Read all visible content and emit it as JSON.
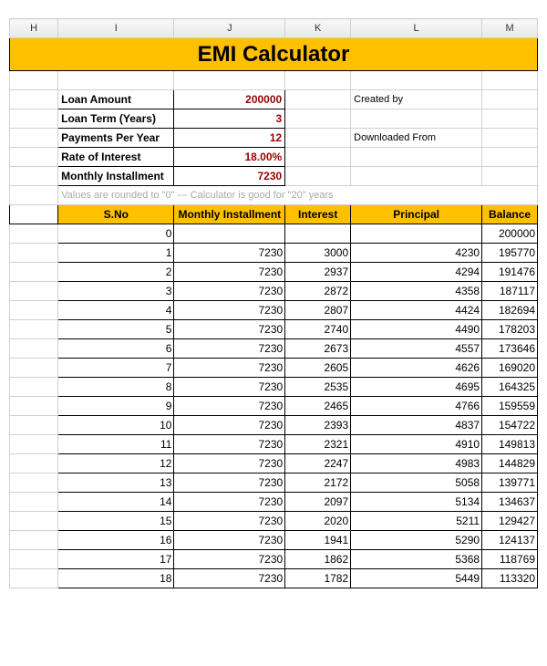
{
  "cols": [
    "H",
    "I",
    "J",
    "K",
    "L",
    "M"
  ],
  "title": "EMI Calculator",
  "inputs": {
    "loan_amount_label": "Loan Amount",
    "loan_amount_value": "200000",
    "loan_term_label": "Loan Term (Years)",
    "loan_term_value": "3",
    "payments_per_year_label": "Payments Per Year",
    "payments_per_year_value": "12",
    "rate_label": "Rate of Interest",
    "rate_value": "18.00%",
    "monthly_installment_label": "Monthly Installment",
    "monthly_installment_value": "7230"
  },
  "side": {
    "created_by": "Created by",
    "downloaded_from": "Downloaded From"
  },
  "note": "Values are rounded to \"0\"  ---  Calculator is good for \"20\" years",
  "table_headers": {
    "sno": "S.No",
    "monthly": "Monthly Installment",
    "interest": "Interest",
    "principal": "Principal",
    "balance": "Balance"
  },
  "rows": [
    {
      "sno": "0",
      "monthly": "",
      "interest": "",
      "principal": "",
      "balance": "200000"
    },
    {
      "sno": "1",
      "monthly": "7230",
      "interest": "3000",
      "principal": "4230",
      "balance": "195770"
    },
    {
      "sno": "2",
      "monthly": "7230",
      "interest": "2937",
      "principal": "4294",
      "balance": "191476"
    },
    {
      "sno": "3",
      "monthly": "7230",
      "interest": "2872",
      "principal": "4358",
      "balance": "187117"
    },
    {
      "sno": "4",
      "monthly": "7230",
      "interest": "2807",
      "principal": "4424",
      "balance": "182694"
    },
    {
      "sno": "5",
      "monthly": "7230",
      "interest": "2740",
      "principal": "4490",
      "balance": "178203"
    },
    {
      "sno": "6",
      "monthly": "7230",
      "interest": "2673",
      "principal": "4557",
      "balance": "173646"
    },
    {
      "sno": "7",
      "monthly": "7230",
      "interest": "2605",
      "principal": "4626",
      "balance": "169020"
    },
    {
      "sno": "8",
      "monthly": "7230",
      "interest": "2535",
      "principal": "4695",
      "balance": "164325"
    },
    {
      "sno": "9",
      "monthly": "7230",
      "interest": "2465",
      "principal": "4766",
      "balance": "159559"
    },
    {
      "sno": "10",
      "monthly": "7230",
      "interest": "2393",
      "principal": "4837",
      "balance": "154722"
    },
    {
      "sno": "11",
      "monthly": "7230",
      "interest": "2321",
      "principal": "4910",
      "balance": "149813"
    },
    {
      "sno": "12",
      "monthly": "7230",
      "interest": "2247",
      "principal": "4983",
      "balance": "144829"
    },
    {
      "sno": "13",
      "monthly": "7230",
      "interest": "2172",
      "principal": "5058",
      "balance": "139771"
    },
    {
      "sno": "14",
      "monthly": "7230",
      "interest": "2097",
      "principal": "5134",
      "balance": "134637"
    },
    {
      "sno": "15",
      "monthly": "7230",
      "interest": "2020",
      "principal": "5211",
      "balance": "129427"
    },
    {
      "sno": "16",
      "monthly": "7230",
      "interest": "1941",
      "principal": "5290",
      "balance": "124137"
    },
    {
      "sno": "17",
      "monthly": "7230",
      "interest": "1862",
      "principal": "5368",
      "balance": "118769"
    },
    {
      "sno": "18",
      "monthly": "7230",
      "interest": "1782",
      "principal": "5449",
      "balance": "113320"
    }
  ]
}
